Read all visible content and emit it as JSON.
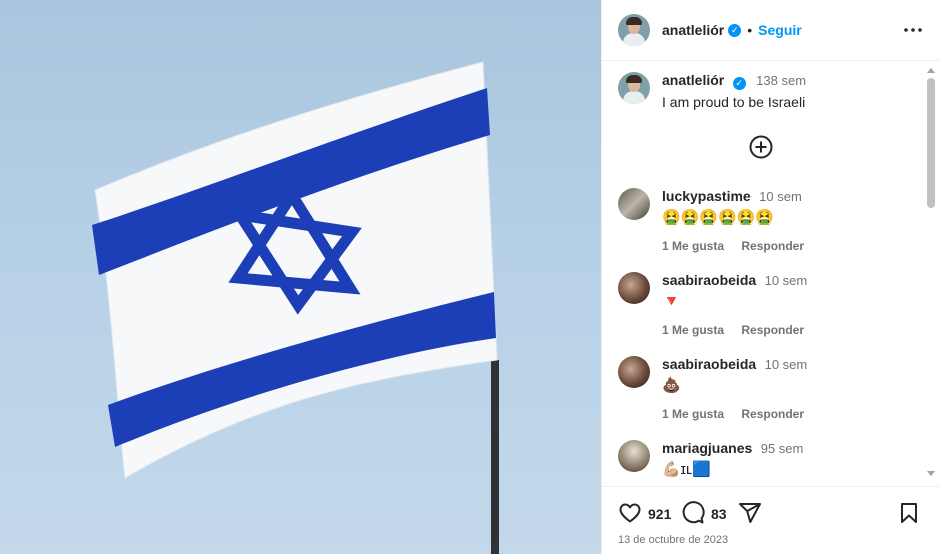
{
  "post": {
    "author": "anatleliór",
    "follow_label": "Seguir",
    "separator": "•",
    "caption_time": "138 sem",
    "caption_text": "I am proud to be Israeli",
    "likes": "921",
    "comment_count": "83",
    "date": "13 de octubre de 2023"
  },
  "comments": [
    {
      "user": "luckypastime",
      "time": "10 sem",
      "text": "🤮🤮🤮🤮🤮🤮",
      "likes": "1 Me gusta",
      "reply": "Responder"
    },
    {
      "user": "saabiraobeida",
      "time": "10 sem",
      "text": "🔻",
      "likes": "1 Me gusta",
      "reply": "Responder"
    },
    {
      "user": "saabiraobeida",
      "time": "10 sem",
      "text": "💩",
      "likes": "1 Me gusta",
      "reply": "Responder"
    },
    {
      "user": "mariagjuanes",
      "time": "95 sem",
      "text": "💪🏼ɪʟ🟦"
    }
  ],
  "colors": {
    "accent": "#0095f6",
    "flag_blue": "#1c3fb8",
    "text_muted": "#737373"
  },
  "icons": [
    "verified-icon",
    "more-options-icon",
    "add-comment-icon",
    "heart-icon",
    "comment-icon",
    "share-icon",
    "bookmark-icon"
  ]
}
